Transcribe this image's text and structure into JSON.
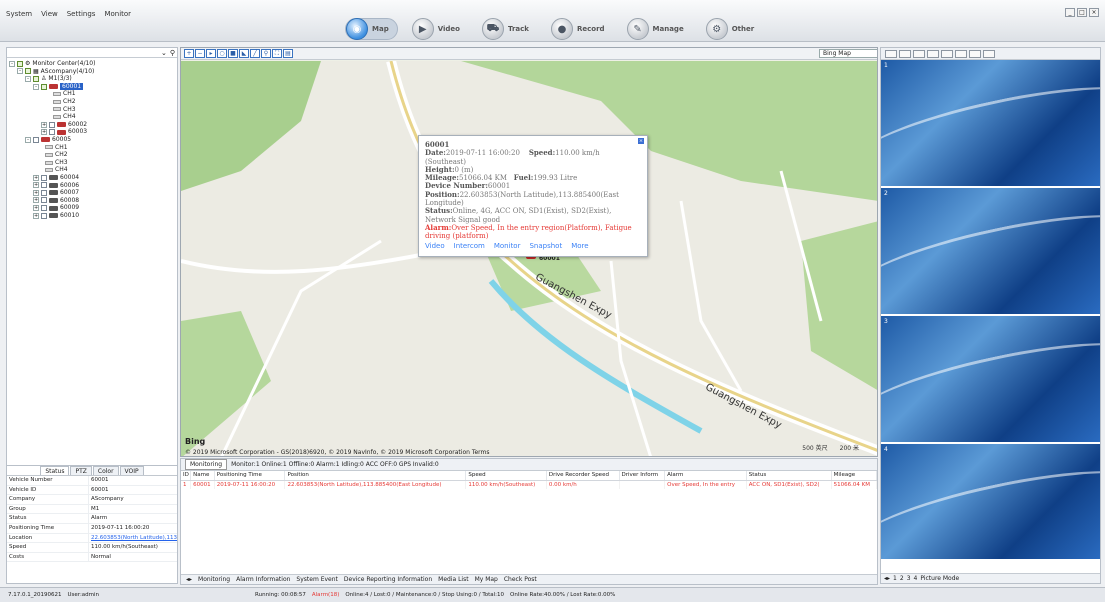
{
  "menu": [
    "System",
    "View",
    "Settings",
    "Monitor"
  ],
  "nav": [
    {
      "label": "Map",
      "icon": "globe-icon",
      "active": true
    },
    {
      "label": "Video",
      "icon": "video-icon",
      "active": false
    },
    {
      "label": "Track",
      "icon": "track-icon",
      "active": false
    },
    {
      "label": "Record",
      "icon": "record-icon",
      "active": false
    },
    {
      "label": "Manage",
      "icon": "manage-icon",
      "active": false
    },
    {
      "label": "Other",
      "icon": "other-icon",
      "active": false
    }
  ],
  "tree": {
    "root": "Monitor Center(4/10)",
    "company": "AScompany(4/10)",
    "group": "M1(3/3)",
    "sel_device": "60001",
    "channels": [
      "CH1",
      "CH2",
      "CH3",
      "CH4"
    ],
    "d2": "60002",
    "d3": "60003",
    "d5": "60005",
    "others": [
      "60004",
      "60006",
      "60007",
      "60008",
      "60009",
      "60010"
    ]
  },
  "info": {
    "tabs": [
      "Status",
      "PTZ",
      "Color",
      "VOIP"
    ],
    "rows": [
      {
        "k": "Vehicle Number",
        "v": "60001"
      },
      {
        "k": "Vehicle ID",
        "v": "60001"
      },
      {
        "k": "Company",
        "v": "AScompany"
      },
      {
        "k": "Group",
        "v": "M1"
      },
      {
        "k": "Status",
        "v": "Alarm"
      },
      {
        "k": "Positioning Time",
        "v": "2019-07-11 16:00:20"
      },
      {
        "k": "Location",
        "v": "22.603853(North Latitude),113"
      },
      {
        "k": "Speed",
        "v": "110.00 km/h(Southeast)"
      },
      {
        "k": "Costs",
        "v": "Normal"
      }
    ]
  },
  "map": {
    "source": "Bing Map",
    "vehicle_label": "60001",
    "bing": "Bing",
    "copyright": "© 2019 Microsoft Corporation - GS(2018)6920, © 2019 NavInfo, © 2019 Microsoft Corporation Terms",
    "scale1": "500 英尺",
    "scale2": "200 米",
    "road": "Guangshen Expy",
    "popup": {
      "title": "60001",
      "date": "2019-07-11 16:00:20",
      "speed": "110.00 km/h",
      "dir": "(Southeast)",
      "height": "0 (m)",
      "mileage": "51066.04 KM",
      "fuel": "199.93 Litre",
      "devnum": "60001",
      "position": "22.603853(North Latitude),113.885400(East Longitude)",
      "status": "Online, 4G, ACC ON, SD1(Exist), SD2(Exist), Network Signal good",
      "alarm": "Over Speed, In the entry region(Platform), Fatigue driving (platform)",
      "links": [
        "Video",
        "Intercom",
        "Monitor",
        "Snapshot",
        "More"
      ]
    }
  },
  "bottom": {
    "mode": "Monitoring",
    "counts": "Monitor:1  Online:1  Offline:0  Alarm:1  Idling:0  ACC OFF:0  GPS Invalid:0",
    "headers": [
      "ID",
      "Name",
      "Positioning Time",
      "Position",
      "Speed",
      "Drive Recorder Speed",
      "Driver Inform",
      "Alarm",
      "Status",
      "Mileage"
    ],
    "row": [
      "1",
      "60001",
      "2019-07-11 16:00:20",
      "22.603853(North Latitude),113.885400(East Longitude)",
      "110.00 km/h(Southeast)",
      "0.00 km/h",
      "",
      "Over Speed, In the entry",
      "ACC ON, SD1(Exist), SD2(",
      "51066.04 KM"
    ],
    "tabs": [
      "Monitoring",
      "Alarm Information",
      "System Event",
      "Device Reporting Information",
      "Media List",
      "My Map",
      "Check Post"
    ]
  },
  "right": {
    "views": [
      "1",
      "2",
      "3",
      "4"
    ],
    "tabs": [
      "1",
      "2",
      "3",
      "4",
      "Picture Mode"
    ]
  },
  "status": {
    "version": "7.17.0.1_20190621",
    "user": "User:admin",
    "runtime": "Running: 00:08:57",
    "alarm": "Alarm(18)",
    "count": "Online:4 / Lost:0 / Maintenance:0 / Stop Using:0 / Total:10",
    "rate": "Online Rate:40.00% / Lost Rate:0.00%"
  }
}
